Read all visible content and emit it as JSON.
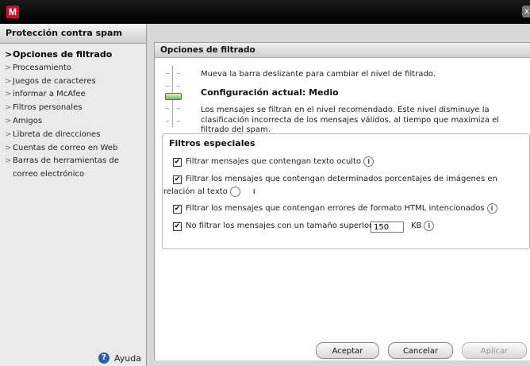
{
  "window": {
    "logo_letter": "M",
    "close_symbol": "x"
  },
  "sidebar": {
    "heading": "Protección contra spam",
    "items": [
      {
        "label": "Opciones de filtrado",
        "active": true
      },
      {
        "label": "Procesamiento"
      },
      {
        "label": "Juegos de caracteres"
      },
      {
        "label": "informar a McAfee"
      },
      {
        "label": "Filtros personales"
      },
      {
        "label": "Amigos"
      },
      {
        "label": "Libreta de direcciones"
      },
      {
        "label": "Cuentas de correo en Web"
      },
      {
        "label": "Barras de herramientas de correo electrónico"
      }
    ],
    "help_label": "Ayuda",
    "arrow_symbol": ">"
  },
  "panel": {
    "title": "Opciones de filtrado",
    "slider_instruction": "Mueva la barra deslizante para cambiar el nivel de filtrado.",
    "current_setting": "Configuración actual: Medio",
    "description": "Los mensajes se filtran en el nivel recomendado. Este nivel disminuye la clasificación incorrecta de los mensajes válidos, al tiempo que maximiza el filtrado del spam.",
    "special_filters_title": "Filtros especiales",
    "options": [
      {
        "label": "Filtrar mensajes que contengan texto oculto",
        "checked": true
      },
      {
        "label": "Filtrar los mensajes que contengan determinados porcentajes de imágenes en relación al texto",
        "checked": true
      },
      {
        "label": "Filtrar los mensajes que contengan errores de formato HTML intencionados",
        "checked": true
      },
      {
        "label": "No filtrar los mensajes con un tamaño superior a:",
        "checked": true
      }
    ],
    "size_value": "150",
    "size_unit": "KB",
    "info_symbol": "i",
    "check_symbol": "✔"
  },
  "buttons": {
    "accept": "Aceptar",
    "cancel": "Cancelar",
    "apply": "Aplicar"
  },
  "colors": {
    "title_bar": "#000000",
    "logo_red": "#c8102e",
    "slider_thumb": "#7ab55c",
    "help_blue": "#2b5fb0"
  }
}
